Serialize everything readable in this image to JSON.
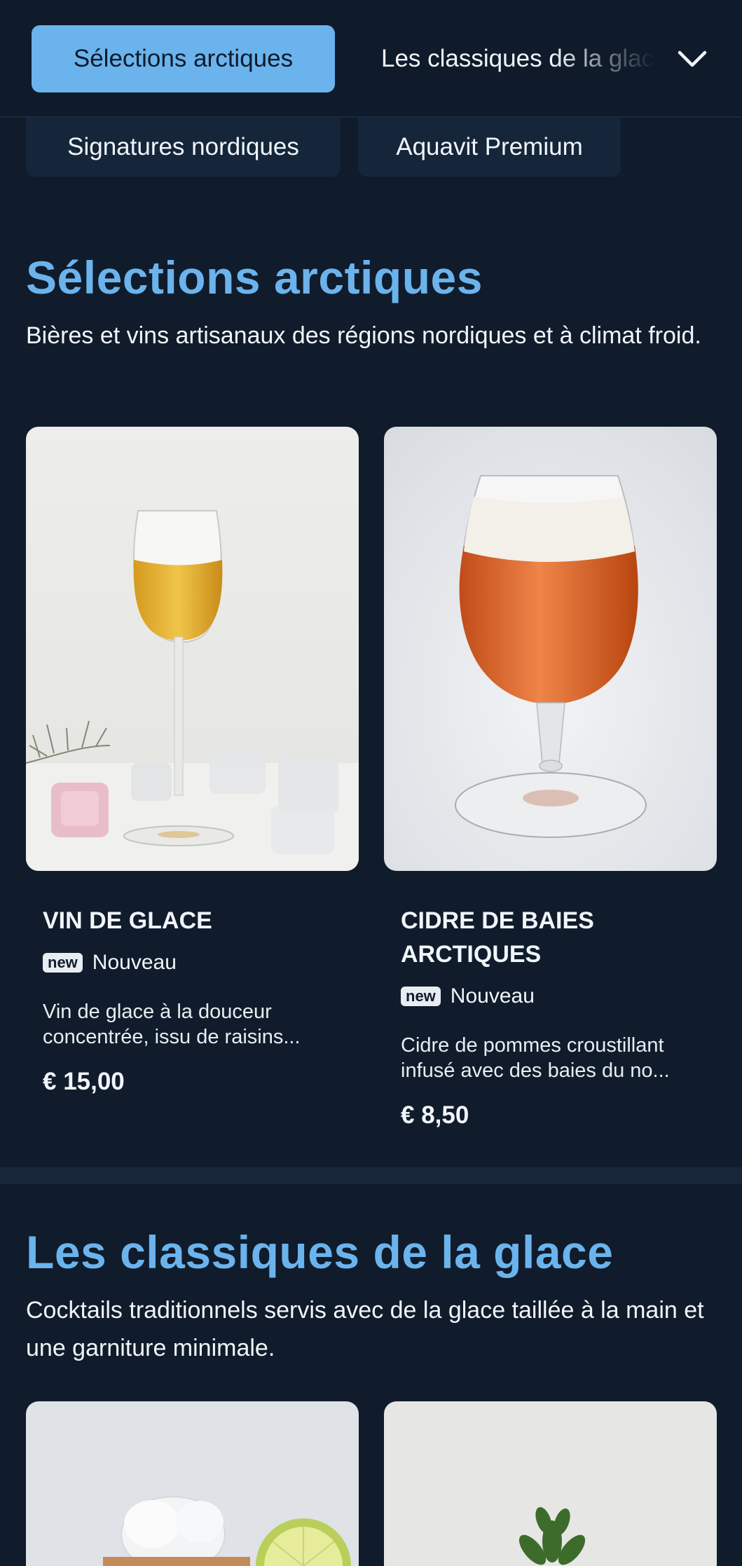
{
  "nav": {
    "active_tab": "Sélections arctiques",
    "next_tab": "Les classiques de la glace",
    "more_icon": "chevron-down-icon",
    "chips": [
      "Signatures nordiques",
      "Aquavit Premium"
    ]
  },
  "sections": [
    {
      "title": "Sélections arctiques",
      "description": "Bières et vins artisanaux des régions nordiques et à climat froid.",
      "items": [
        {
          "name": "VIN DE GLACE",
          "badge": "new",
          "badge_label": "Nouveau",
          "description": "Vin de glace à la douceur concentrée, issu de raisins...",
          "price": "€ 15,00"
        },
        {
          "name": "CIDRE DE BAIES ARCTIQUES",
          "badge": "new",
          "badge_label": "Nouveau",
          "description": "Cidre de pommes croustillant infusé avec des baies du no...",
          "price": "€ 8,50"
        }
      ]
    },
    {
      "title": "Les classiques de la glace",
      "description": "Cocktails traditionnels servis avec de la glace taillée à la main et une garniture minimale."
    }
  ],
  "colors": {
    "background": "#101c2b",
    "accent": "#6bb3ed",
    "chip": "#15263a"
  }
}
